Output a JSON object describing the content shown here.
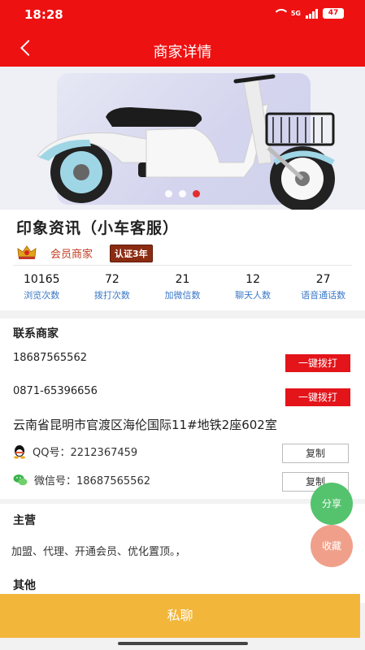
{
  "status_bar": {
    "time": "18:28",
    "network": "5G",
    "battery": "47"
  },
  "header": {
    "title": "商家详情"
  },
  "banner": {
    "slide_count": 3,
    "active_index": 2
  },
  "merchant": {
    "name": "印象资讯（小车客服）",
    "type_label": "会员商家",
    "cert_label": "认证3年",
    "stats": [
      {
        "value": "10165",
        "label": "浏览次数"
      },
      {
        "value": "72",
        "label": "拨打次数"
      },
      {
        "value": "21",
        "label": "加微信数"
      },
      {
        "value": "12",
        "label": "聊天人数"
      },
      {
        "value": "27",
        "label": "语音通话数"
      }
    ]
  },
  "contact": {
    "heading": "联系商家",
    "phone1": "18687565562",
    "phone2": "0871-65396656",
    "call_label": "一键拨打",
    "address": "云南省昆明市官渡区海伦国际11#地铁2座602室",
    "qq": "QQ号：2212367459",
    "wechat": "微信号：18687565562",
    "copy_label": "复制"
  },
  "main_business": {
    "heading": "主营",
    "text": "加盟、代理、开通会员、优化置顶。，"
  },
  "other": {
    "heading": "其他"
  },
  "floating": {
    "share": "分享",
    "favorite": "收藏"
  },
  "bottom": {
    "chat_label": "私聊"
  },
  "colors": {
    "brand_red": "#ee1111",
    "chat_bar": "#f2b63a",
    "share_green": "#55c36e",
    "fav_salmon": "#f0a08a",
    "stat_label_blue": "#3a79c7"
  }
}
